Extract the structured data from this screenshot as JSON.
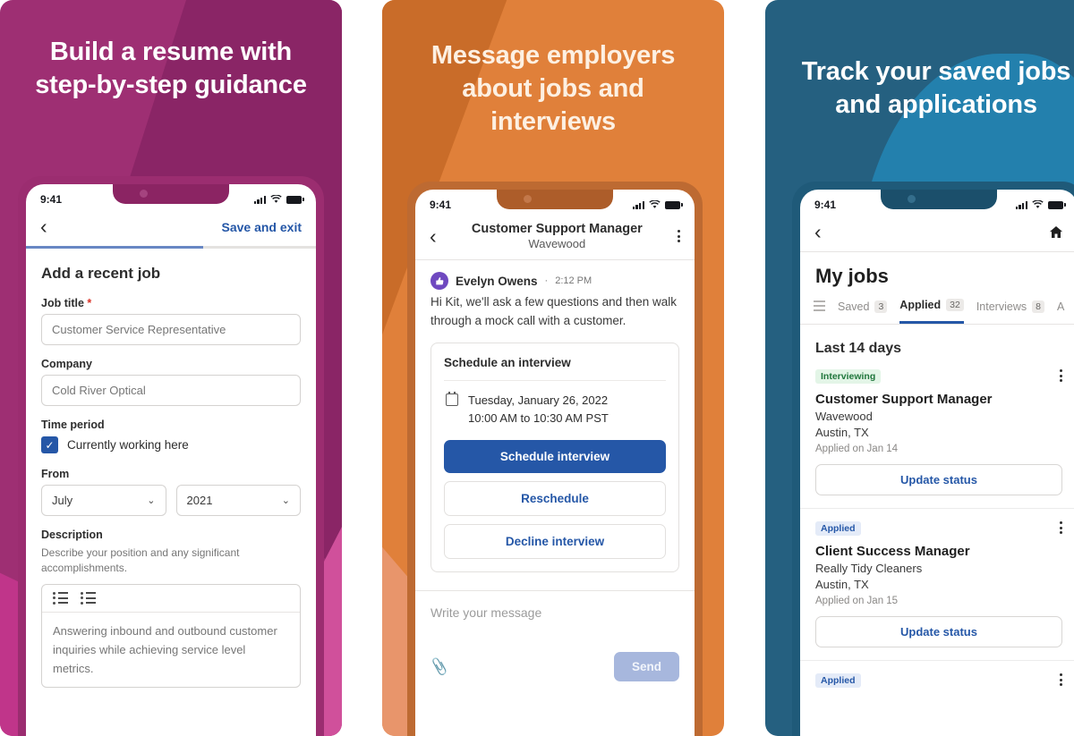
{
  "colors": {
    "panel1_bg": "#9e2f73",
    "panel2_bg": "#e0803a",
    "panel3_bg": "#256080",
    "accent_blue": "#2557a7",
    "chip_green": "#20763c",
    "avatar_purple": "#6f49c0"
  },
  "panels": [
    {
      "headline": "Build a resume with step-by-step guidance",
      "status": {
        "time": "9:41"
      },
      "nav": {
        "back": "‹",
        "save_exit": "Save and exit"
      },
      "progress_percent": 61,
      "form": {
        "section_title": "Add a recent job",
        "job_title_label": "Job title",
        "required_mark": "*",
        "job_title_value": "Customer Service Representative",
        "company_label": "Company",
        "company_value": "Cold River Optical",
        "time_period_label": "Time period",
        "currently_working_label": "Currently working here",
        "currently_working_checked": "✓",
        "from_label": "From",
        "from_month": "July",
        "from_year": "2021",
        "caret": "⌄",
        "description_label": "Description",
        "description_hint": "Describe your position and any significant accomplishments.",
        "description_value": "Answering inbound and outbound customer inquiries while achieving service level metrics."
      }
    },
    {
      "headline": "Message employers about jobs and interviews",
      "status": {
        "time": "9:41"
      },
      "nav": {
        "back": "‹"
      },
      "chat": {
        "title": "Customer Support Manager",
        "subtitle": "Wavewood",
        "message": {
          "sender": "Evelyn Owens",
          "time_separator": "·",
          "time": "2:12 PM",
          "body": "Hi Kit, we'll ask a few questions and then walk through a mock call with a customer."
        },
        "card": {
          "title": "Schedule an interview",
          "date": "Tuesday, January 26, 2022",
          "time_range": "10:00 AM to 10:30 AM PST",
          "primary_button": "Schedule interview",
          "secondary_button": "Reschedule",
          "tertiary_button": "Decline interview"
        },
        "composer": {
          "placeholder": "Write your message",
          "attach_icon": "📎",
          "send_label": "Send"
        }
      }
    },
    {
      "headline": "Track your saved jobs and applications",
      "status": {
        "time": "9:41"
      },
      "nav": {
        "back": "‹",
        "home_icon": "⌂"
      },
      "myjobs": {
        "page_title": "My jobs",
        "tabs": [
          {
            "label": "Saved",
            "badge": "3",
            "active": false
          },
          {
            "label": "Applied",
            "badge": "32",
            "active": true
          },
          {
            "label": "Interviews",
            "badge": "8",
            "active": false
          },
          {
            "label": "A",
            "badge": "",
            "active": false
          }
        ],
        "section_header": "Last 14 days",
        "cards": [
          {
            "status": "Interviewing",
            "status_type": "interviewing",
            "title": "Customer Support Manager",
            "company": "Wavewood",
            "location": "Austin, TX",
            "applied": "Applied on Jan 14",
            "action": "Update status"
          },
          {
            "status": "Applied",
            "status_type": "applied",
            "title": "Client Success Manager",
            "company": "Really Tidy Cleaners",
            "location": "Austin, TX",
            "applied": "Applied on Jan 15",
            "action": "Update status"
          },
          {
            "status": "Applied",
            "status_type": "applied",
            "title": "",
            "company": "",
            "location": "",
            "applied": "",
            "action": ""
          }
        ]
      }
    }
  ]
}
